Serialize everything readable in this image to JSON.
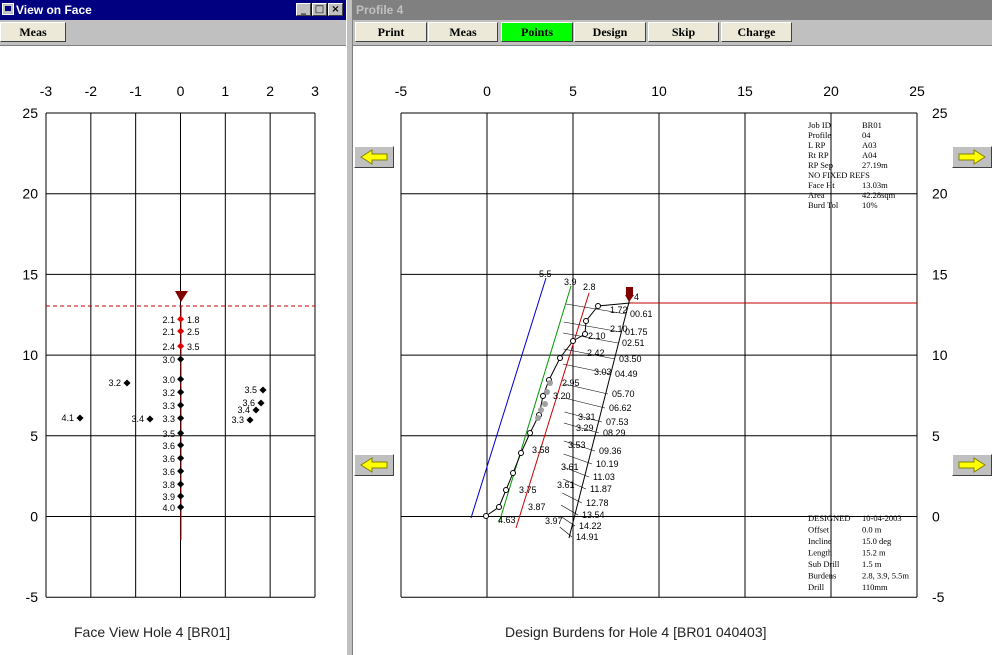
{
  "left_window": {
    "title": "View on Face",
    "minimize": "_",
    "maximize": "□",
    "close": "×",
    "meas_button": "Meas",
    "caption": "Face View Hole 4 [BR01]",
    "x_ticks": [
      "-3",
      "-2",
      "-1",
      "0",
      "1",
      "2",
      "3"
    ],
    "y_ticks": [
      "25",
      "20",
      "15",
      "10",
      "5",
      "0",
      "-5"
    ],
    "face_labels": {
      "col_left": [
        {
          "text": "2.1",
          "color": "#e00000"
        },
        {
          "text": "2.1",
          "color": "#e00000"
        },
        {
          "text": "2.4",
          "color": "#e00000"
        },
        {
          "text": "3.0"
        },
        {
          "text": "3.0"
        },
        {
          "text": "3.2"
        },
        {
          "text": "3.3"
        },
        {
          "text": "3.3"
        },
        {
          "text": "3.5"
        },
        {
          "text": "3.6"
        },
        {
          "text": "3.6"
        },
        {
          "text": "3.6"
        },
        {
          "text": "3.8"
        },
        {
          "text": "3.9"
        },
        {
          "text": "4.0"
        }
      ],
      "col_right": [
        "1.8",
        "2.5",
        "3.5"
      ],
      "scatter_left": [
        "3.2",
        "4.1",
        "3.4"
      ],
      "scatter_right": [
        "3.5",
        "3.6",
        "3.4",
        "3.3"
      ]
    }
  },
  "right_window": {
    "title": "Profile 4",
    "toolbar": [
      "Print",
      "Meas",
      "Points",
      "Design",
      "Skip",
      "Charge"
    ],
    "active_tool": "Points",
    "caption": "Design Burdens for Hole  4 [BR01 040403]",
    "x_ticks": [
      "-5",
      "0",
      "5",
      "10",
      "15",
      "20",
      "25"
    ],
    "y_ticks": [
      "25",
      "20",
      "15",
      "10",
      "5",
      "0",
      "-5"
    ],
    "info_top": [
      [
        "Job ID",
        "BR01"
      ],
      [
        "Profile",
        "04"
      ],
      [
        "L RP",
        "A03"
      ],
      [
        "Rt RP",
        "A04"
      ],
      [
        "RP Sep",
        "27.19m"
      ],
      [
        "NO FIXED REFS",
        ""
      ],
      [
        "Face Ht",
        "13.03m"
      ],
      [
        "Area",
        "42.28sqm"
      ],
      [
        "Burd Tol",
        "10%"
      ]
    ],
    "info_bottom": [
      [
        "DESIGNED",
        "10-04-2003"
      ],
      [
        "Offset",
        "0.0 m"
      ],
      [
        "Incline",
        "15.0 deg"
      ],
      [
        "Length",
        "15.2 m"
      ],
      [
        "Sub Drill",
        "1.5 m"
      ],
      [
        "Burdens",
        "2.8, 3.9, 5.5m"
      ],
      [
        "Drill",
        "110mm"
      ]
    ],
    "line_labels": [
      "5.5",
      "3.9",
      "2.8"
    ],
    "hole_label": "4",
    "depth_labels": [
      "00.61",
      "01.75",
      "02.51",
      "03.50",
      "04.49",
      "05.70",
      "06.62",
      "07.53",
      "08.29",
      "09.36",
      "10.19",
      "11.03",
      "11.87",
      "12.78",
      "13.54",
      "14.22",
      "14.91"
    ],
    "red_burdens": [
      "1.72",
      "2.10",
      "2.10",
      "2.42"
    ],
    "black_burdens": [
      "3.03",
      "2.95",
      "3.20",
      "3.31",
      "3.29",
      "3.53",
      "3.58",
      "3.61",
      "3.61",
      "3.75",
      "3.87",
      "3.97",
      "4.63"
    ]
  }
}
